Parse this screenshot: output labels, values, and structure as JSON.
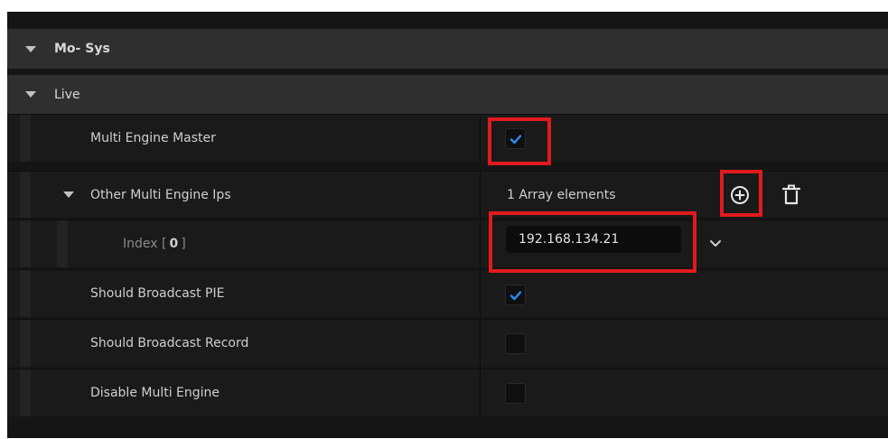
{
  "categories": {
    "mosys": "Mo- Sys",
    "live": "Live"
  },
  "properties": {
    "multi_engine_master": {
      "label": "Multi Engine Master",
      "checked": true
    },
    "other_ips": {
      "label": "Other Multi Engine Ips",
      "array_text": "1 Array elements"
    },
    "index0": {
      "label_prefix": "Index [",
      "index": "0",
      "label_suffix": "]",
      "value": "192.168.134.21"
    },
    "broadcast_pie": {
      "label": "Should Broadcast PIE",
      "checked": true
    },
    "broadcast_record": {
      "label": "Should Broadcast Record",
      "checked": false
    },
    "disable_multi_engine": {
      "label": "Disable Multi Engine",
      "checked": false
    }
  },
  "icons": {
    "add": "plus-circle-icon",
    "delete": "trash-icon",
    "dropdown": "chevron-down-icon",
    "check": "checkmark-icon",
    "expand": "triangle-down-icon"
  },
  "colors": {
    "accent_check": "#2a8cf2",
    "highlight": "#e01a1e"
  }
}
